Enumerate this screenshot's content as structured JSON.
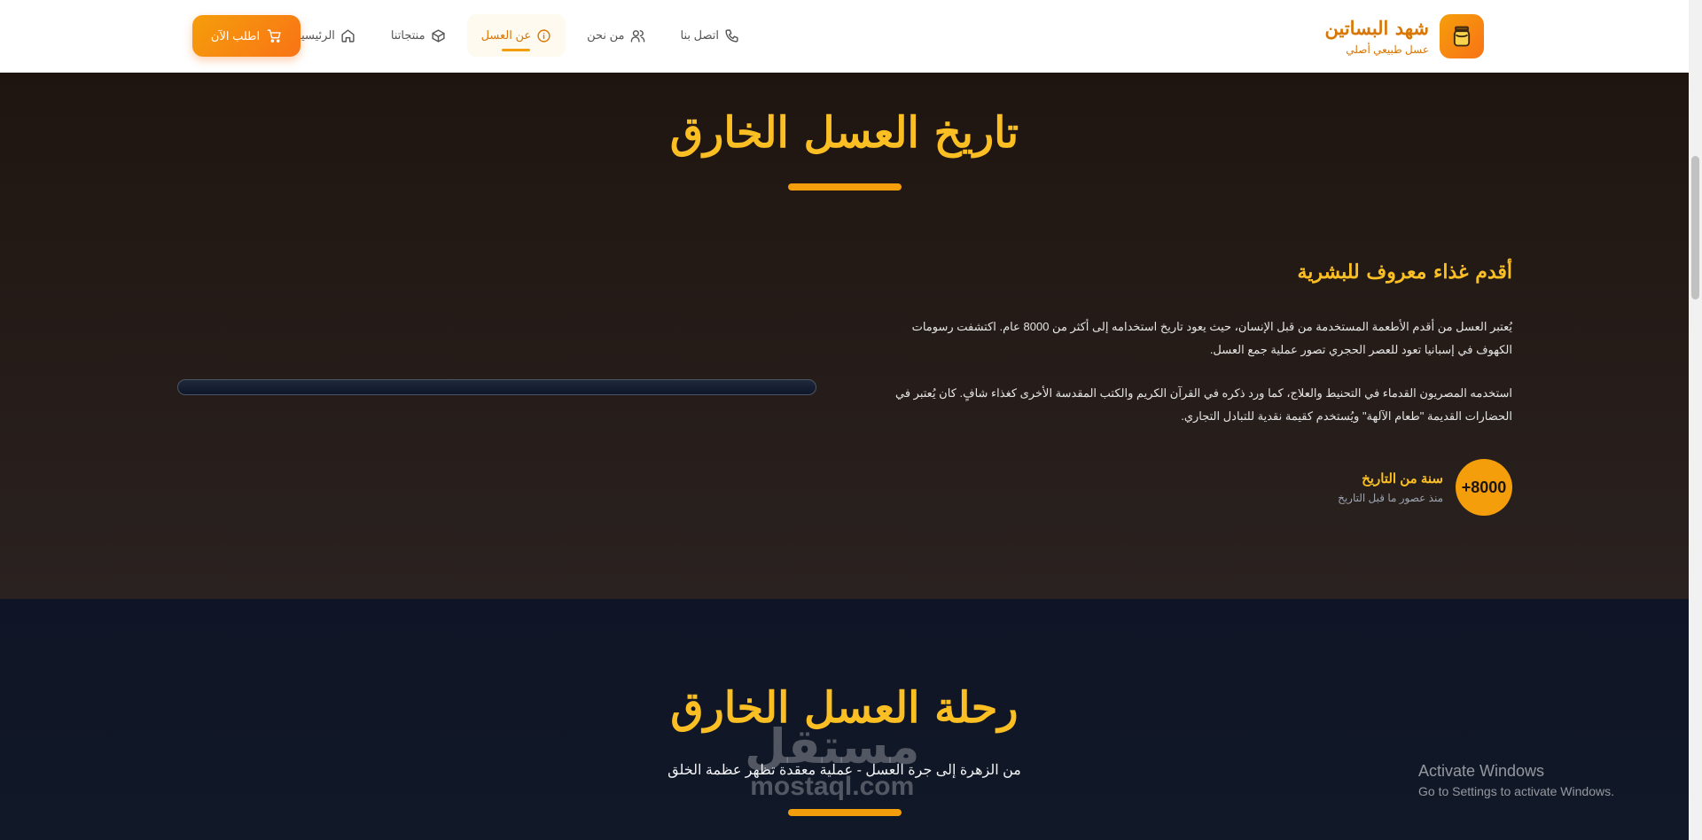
{
  "header": {
    "brand_name": "شهد البساتين",
    "brand_sub": "عسل طبيعي أصلي",
    "logo_icon": "honey-jar-icon",
    "nav": [
      {
        "label": "الرئيسية",
        "icon": "home-icon"
      },
      {
        "label": "منتجاتنا",
        "icon": "box-icon"
      },
      {
        "label": "عن العسل",
        "icon": "info-icon",
        "active": true
      },
      {
        "label": "من نحن",
        "icon": "users-icon"
      },
      {
        "label": "اتصل بنا",
        "icon": "phone-icon"
      }
    ],
    "order_label": "اطلب الآن",
    "order_icon": "cart-icon"
  },
  "history": {
    "title": "تاريخ العسل الخارق",
    "subtitle": "أقدم غذاء معروف للبشرية",
    "para1": "يُعتبر العسل من أقدم الأطعمة المستخدمة من قبل الإنسان، حيث يعود تاريخ استخدامه إلى أكثر من 8000 عام. اكتشفت رسومات الكهوف في إسبانيا تعود للعصر الحجري تصور عملية جمع العسل.",
    "para2": "استخدمه المصريون القدماء في التحنيط والعلاج، كما ورد ذكره في القرآن الكريم والكتب المقدسة الأخرى كغذاء شافٍ. كان يُعتبر في الحضارات القديمة \"طعام الآلهة\" ويُستخدم كقيمة نقدية للتبادل التجاري.",
    "stat_value": "+8000",
    "stat_label": "سنة من التاريخ",
    "stat_sub": "منذ عصور ما قبل التاريخ"
  },
  "journey": {
    "title": "رحلة العسل الخارق",
    "subtitle": "من الزهرة إلى جرة العسل - عملية معقدة تظهر عظمة الخلق"
  },
  "watermark": {
    "ar": "مستقل",
    "en": "mostaql.com"
  },
  "os_notice": {
    "title": "Activate Windows",
    "sub": "Go to Settings to activate Windows."
  },
  "colors": {
    "accent": "#f59e0b",
    "gold_text": "#fbbf24",
    "brand_text": "#d97706"
  }
}
